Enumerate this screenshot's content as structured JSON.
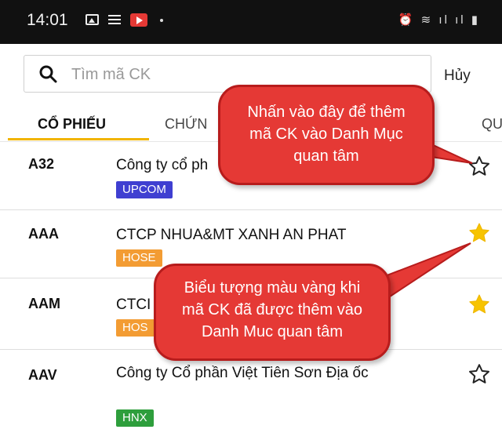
{
  "status_bar": {
    "time": "14:01"
  },
  "search": {
    "placeholder": "Tìm mã CK",
    "cancel_label": "Hủy"
  },
  "tabs": [
    {
      "label": "CỔ PHIẾU",
      "active": true
    },
    {
      "label": "CHỨN"
    },
    {
      "label": "QU"
    }
  ],
  "rows": [
    {
      "code": "A32",
      "name": "Công ty cổ ph",
      "exchange": "UPCOM",
      "exchange_color": "#3f3fd1",
      "watchlisted": false
    },
    {
      "code": "AAA",
      "name": "CTCP NHUA&MT XANH AN PHAT",
      "exchange": "HOSE",
      "exchange_color": "#f39c33",
      "watchlisted": true
    },
    {
      "code": "AAM",
      "name": "CTCI",
      "exchange": "HOS",
      "exchange_color": "#f39c33",
      "watchlisted": true
    },
    {
      "code": "AAV",
      "name": "Công ty Cổ phần Việt Tiên Sơn Địa ốc",
      "exchange": "HNX",
      "exchange_color": "#2e9e3c",
      "watchlisted": false
    }
  ],
  "callouts": {
    "add": [
      "Nhấn vào đây để thêm",
      "mã CK vào Danh Mục",
      "quan tâm"
    ],
    "added": [
      "Biểu tượng màu vàng khi",
      "mã CK đã được thêm vào",
      "Danh Muc quan tâm"
    ]
  },
  "colors": {
    "star_active": "#f7c400",
    "tab_accent": "#f1b400",
    "callout": "#e53935"
  }
}
